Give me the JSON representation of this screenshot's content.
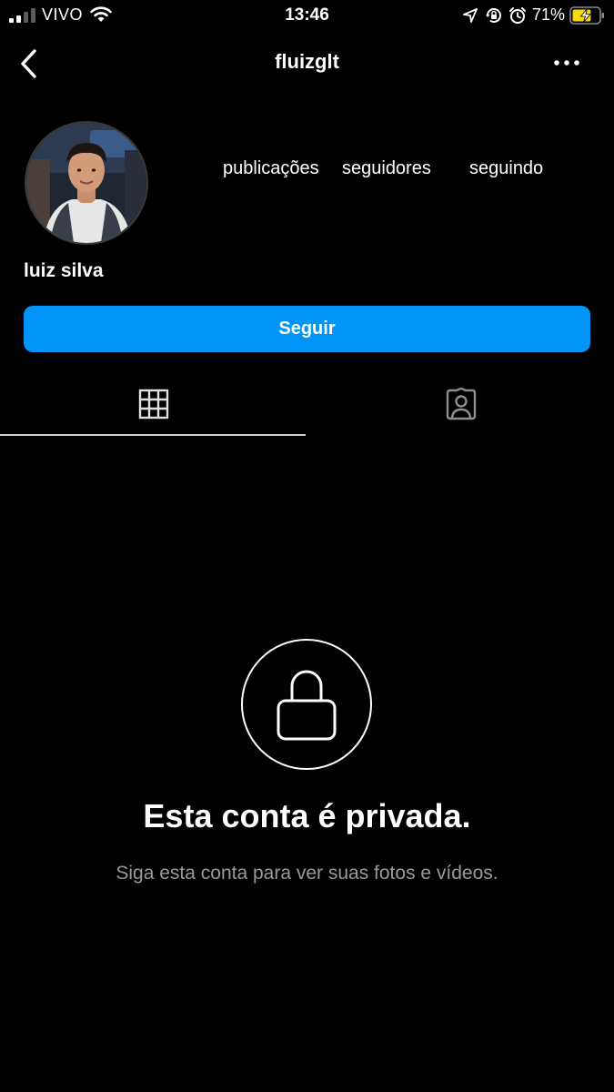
{
  "status_bar": {
    "carrier": "VIVO",
    "time": "13:46",
    "battery_percent": "71%",
    "battery_level": 0.71,
    "signal_bars_active": 2,
    "icons": [
      "signal-icon",
      "wifi-icon",
      "location-icon",
      "rotation-lock-icon",
      "alarm-icon",
      "battery-charging-icon"
    ]
  },
  "header": {
    "username": "fluizglt",
    "back_icon": "chevron-left-icon",
    "more_icon": "more-horizontal-icon"
  },
  "profile": {
    "display_name": "luiz silva",
    "stats": {
      "posts_label": "publicações",
      "followers_label": "seguidores",
      "following_label": "seguindo"
    },
    "follow_label": "Seguir"
  },
  "tabs": [
    {
      "icon": "grid-icon",
      "selected": true
    },
    {
      "icon": "tagged-person-icon",
      "selected": false
    }
  ],
  "private_notice": {
    "icon": "lock-icon",
    "title": "Esta conta é privada.",
    "subtitle": "Siga esta conta para ver suas fotos e vídeos."
  },
  "colors": {
    "background": "#000000",
    "accent": "#0095f6",
    "text_primary": "#ffffff",
    "text_secondary": "#9a9a9a",
    "battery_charging": "#f5d90a"
  }
}
